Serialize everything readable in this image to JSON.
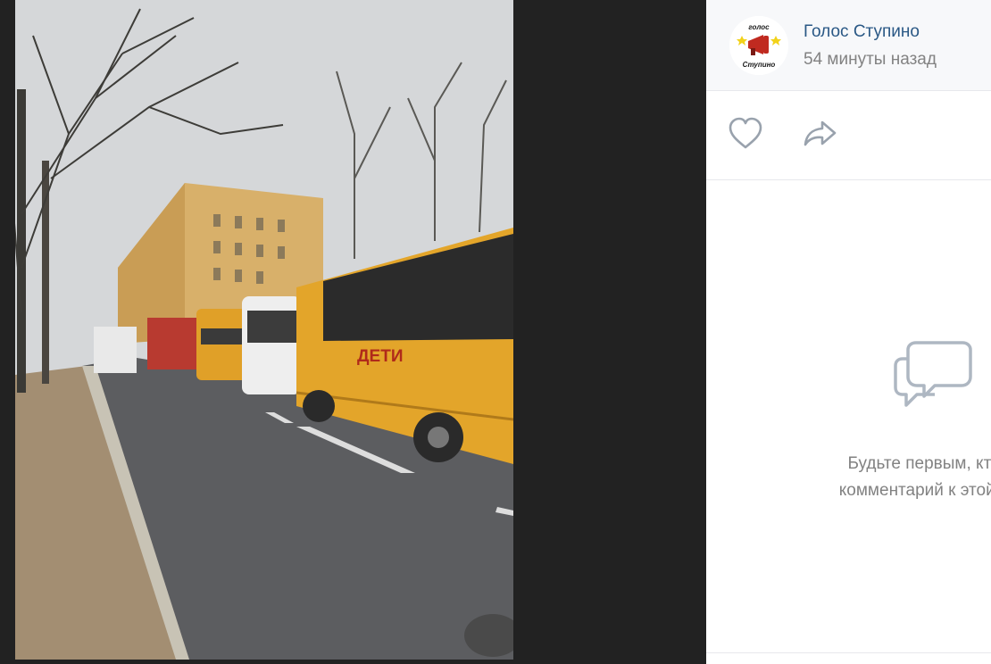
{
  "post": {
    "author": "Голос Ступино",
    "time": "54 минуты назад",
    "avatar_caption_top": "голос",
    "avatar_caption_bottom": "Ступино"
  },
  "actions": {
    "like_icon": "heart-icon",
    "share_icon": "share-arrow-icon"
  },
  "comments": {
    "empty_icon": "comment-bubbles-icon",
    "empty_line1": "Будьте первым, кто о",
    "empty_line2": "комментарий к этой фо"
  },
  "photo": {
    "bus_sign": "ДЕТИ",
    "alt": "street scene with school buses"
  },
  "colors": {
    "link": "#2a5885",
    "muted": "#828282",
    "viewer_bg": "#222222",
    "header_bg": "#f7f8fa",
    "bus_yellow": "#e3a52a"
  }
}
